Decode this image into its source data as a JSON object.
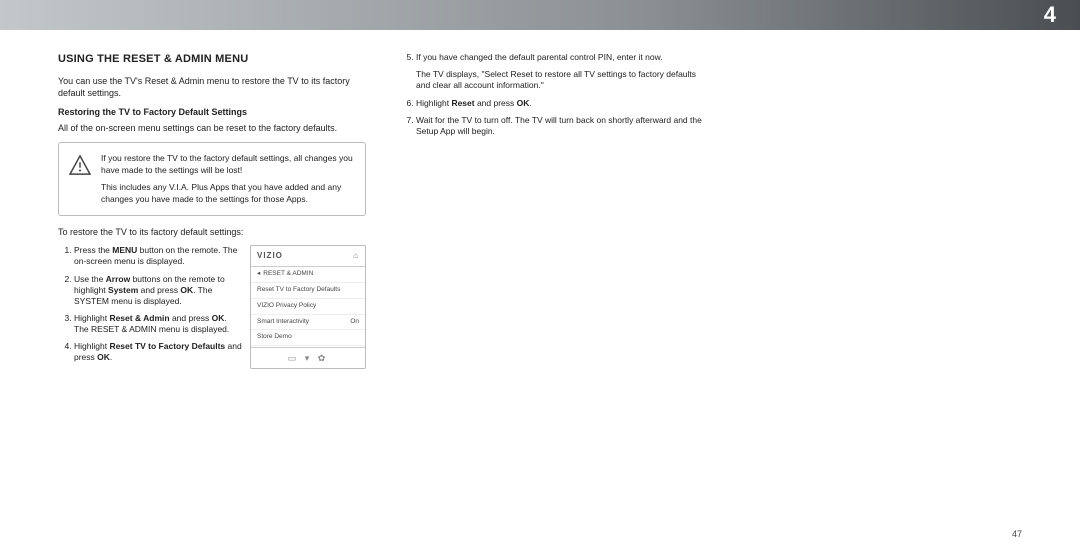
{
  "chapter_number": "4",
  "page_number": "47",
  "left": {
    "heading": "USING THE RESET & ADMIN MENU",
    "intro": "You can use the TV's Reset & Admin menu to restore the TV to its factory default settings.",
    "subhead": "Restoring the TV to Factory Default Settings",
    "para1": "All of the on-screen menu settings can be reset to the factory defaults.",
    "warn1": "If you restore the TV to the factory default settings, all changes you have made to the settings will be lost!",
    "warn2": "This includes any V.I.A. Plus Apps that you have added and any changes you have made to the settings for those Apps.",
    "para2": "To restore the TV to its factory default settings:",
    "steps": [
      {
        "pre": "Press the ",
        "b": "MENU",
        "post": " button on the remote. The on-screen menu is displayed."
      },
      {
        "pre": "Use the ",
        "b": "Arrow",
        "mid": " buttons on the remote to highlight ",
        "b2": "System",
        "mid2": " and press ",
        "b3": "OK",
        "post": ". The SYSTEM menu is displayed."
      },
      {
        "pre": "Highlight ",
        "b": "Reset & Admin",
        "mid": " and press ",
        "b2": "OK",
        "post": ". The RESET & ADMIN menu is displayed."
      },
      {
        "pre": "Highlight ",
        "b": "Reset TV to Factory Defaults",
        "mid": " and press ",
        "b2": "OK",
        "post": "."
      }
    ],
    "tv": {
      "brand": "VIZIO",
      "section_label": "RESET & ADMIN",
      "items": [
        {
          "label": "Reset TV to Factory Defaults",
          "val": ""
        },
        {
          "label": "VIZIO Privacy Policy",
          "val": ""
        },
        {
          "label": "Smart Interactivity",
          "val": "On"
        },
        {
          "label": "Store Demo",
          "val": ""
        }
      ],
      "footer": "▭ ▾ ✿"
    }
  },
  "right": {
    "steps": [
      {
        "num": "5.",
        "text": "If you have changed the default parental control PIN, enter it now.",
        "after": "The TV displays, \"Select Reset to restore all TV settings to factory defaults and clear all account information.\""
      },
      {
        "num": "6.",
        "pre": "Highlight ",
        "b": "Reset",
        "mid": " and press ",
        "b2": "OK",
        "post": "."
      },
      {
        "num": "7.",
        "text": "Wait for the TV to turn off. The TV will turn back on shortly afterward and the Setup App will begin."
      }
    ]
  }
}
